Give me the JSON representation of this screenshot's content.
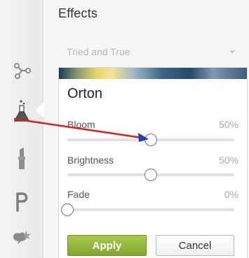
{
  "rail": {
    "items": [
      {
        "icon": "molecule-icon"
      },
      {
        "icon": "flask-icon",
        "active": true
      },
      {
        "icon": "lipstick-icon"
      },
      {
        "icon": "letter-p-icon"
      },
      {
        "icon": "speech-bubble-icon"
      }
    ]
  },
  "panel": {
    "title": "Effects",
    "preset": {
      "value": "Tried and True"
    },
    "effect": {
      "name": "Orton",
      "sliders": [
        {
          "label": "Bloom",
          "value_text": "50%",
          "level": 0.5
        },
        {
          "label": "Brightness",
          "value_text": "50%",
          "level": 0.5
        },
        {
          "label": "Fade",
          "value_text": "0%",
          "level": 0.0
        }
      ]
    },
    "buttons": {
      "apply": "Apply",
      "cancel": "Cancel"
    }
  },
  "colors": {
    "apply_green": "#94b53a",
    "annotation_red": "#d81f1f",
    "annotation_blue": "#1f3fb5"
  }
}
